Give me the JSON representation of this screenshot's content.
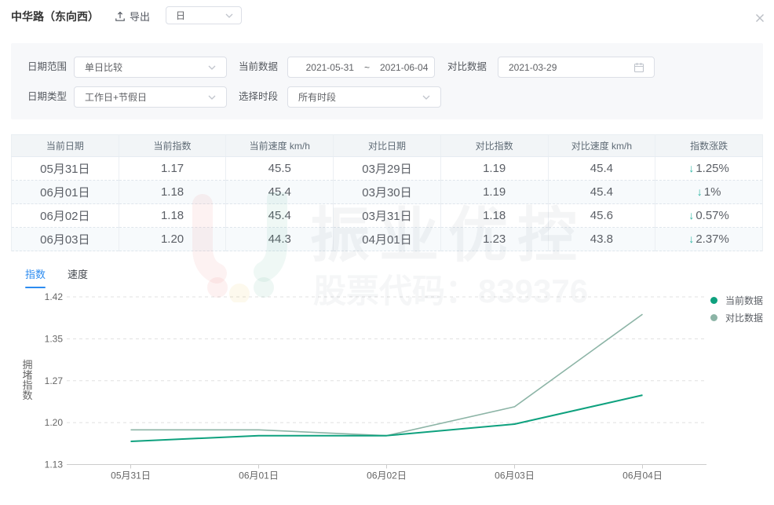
{
  "header": {
    "title": "中华路（东向西）",
    "export_label": "导出",
    "granularity": {
      "value": "日"
    }
  },
  "filters": {
    "date_range": {
      "label": "日期范围",
      "value": "单日比较"
    },
    "current_data": {
      "label": "当前数据",
      "start": "2021-05-31",
      "separator": "~",
      "end": "2021-06-04"
    },
    "compare_data": {
      "label": "对比数据",
      "value": "2021-03-29"
    },
    "date_type": {
      "label": "日期类型",
      "value": "工作日+节假日"
    },
    "time_period": {
      "label": "选择时段",
      "value": "所有时段"
    }
  },
  "table": {
    "columns": [
      "当前日期",
      "当前指数",
      "当前速度 km/h",
      "对比日期",
      "对比指数",
      "对比速度 km/h",
      "指数涨跌"
    ],
    "rows": [
      {
        "cells": [
          "05月31日",
          "1.17",
          "45.5",
          "03月29日",
          "1.19",
          "45.4"
        ],
        "change": "1.25%",
        "direction": "down"
      },
      {
        "cells": [
          "06月01日",
          "1.18",
          "45.4",
          "03月30日",
          "1.19",
          "45.4"
        ],
        "change": "1%",
        "direction": "down"
      },
      {
        "cells": [
          "06月02日",
          "1.18",
          "45.4",
          "03月31日",
          "1.18",
          "45.6"
        ],
        "change": "0.57%",
        "direction": "down"
      },
      {
        "cells": [
          "06月03日",
          "1.20",
          "44.3",
          "04月01日",
          "1.23",
          "43.8"
        ],
        "change": "2.37%",
        "direction": "down"
      }
    ],
    "down_arrow": "↓"
  },
  "watermark": {
    "brand": "振业优控",
    "stock": "股票代码：839376"
  },
  "tabs": [
    {
      "label": "指数",
      "active": true
    },
    {
      "label": "速度",
      "active": false
    }
  ],
  "chart_data": {
    "type": "line",
    "x": [
      "05月31日",
      "06月01日",
      "06月02日",
      "06月03日",
      "06月04日"
    ],
    "series": [
      {
        "name": "当前数据",
        "color": "#0ea17e",
        "values": [
          1.17,
          1.18,
          1.18,
          1.2,
          1.25
        ]
      },
      {
        "name": "对比数据",
        "color": "#8cb4a6",
        "values": [
          1.19,
          1.19,
          1.18,
          1.23,
          1.39
        ]
      }
    ],
    "ylabel": "拥堵指数",
    "yticks": [
      1.13,
      1.2,
      1.27,
      1.35,
      1.42
    ],
    "ylim": [
      1.13,
      1.42
    ],
    "grid": "horizontal-dashed",
    "legend_position": "right"
  },
  "colors": {
    "accent_blue": "#2d8cf0",
    "down_green": "#2db5a3"
  }
}
